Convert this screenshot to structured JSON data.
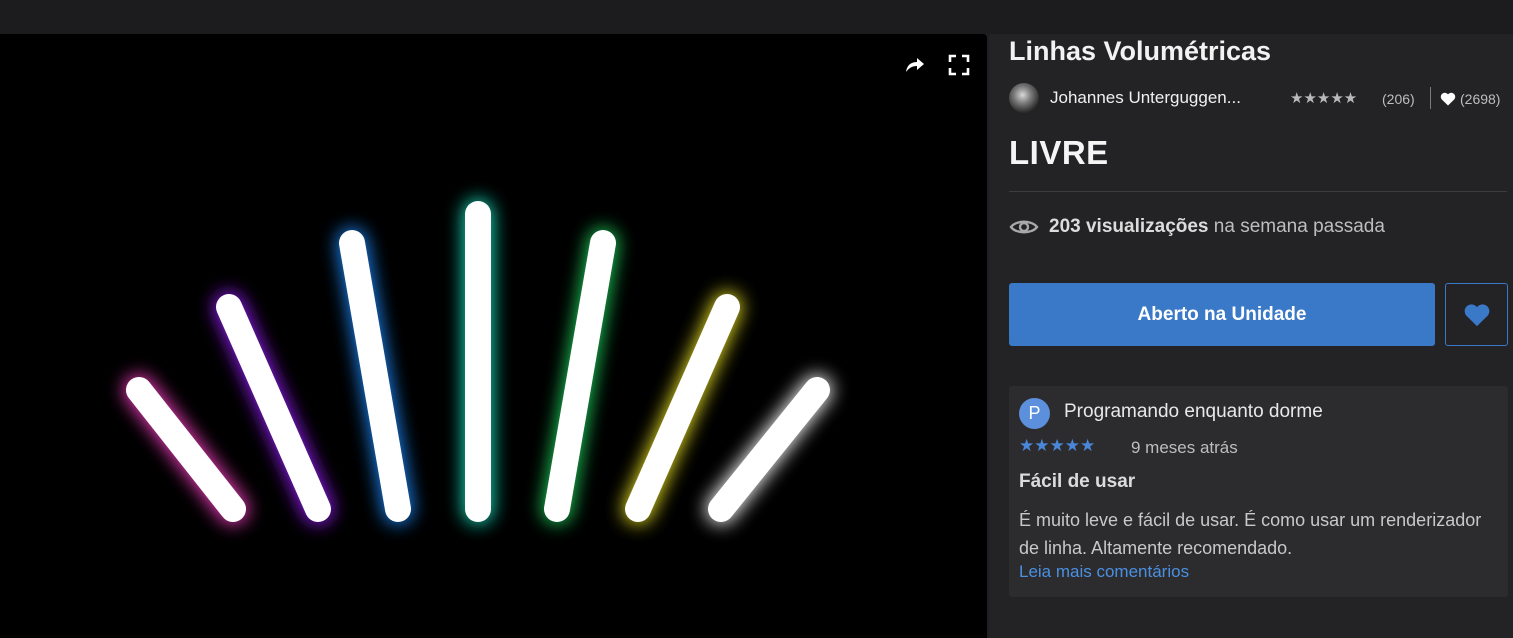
{
  "viewer": {
    "share_icon": "share-arrow-icon",
    "fullscreen_icon": "fullscreen-icon"
  },
  "asset": {
    "title": "Linhas Volumétricas",
    "author": "Johannes Unterguggen...",
    "stars": "★★★★★",
    "rating_count": "(206)",
    "favorites_count": "(2698)",
    "price": "LIVRE"
  },
  "views": {
    "count": "203 visualizações",
    "suffix": "na semana passada"
  },
  "actions": {
    "open_label": "Aberto na Unidade",
    "favorite_icon": "heart-icon"
  },
  "review": {
    "avatar_letter": "P",
    "author": "Programando enquanto dorme",
    "stars": "★★★★★",
    "time": "9 meses atrás",
    "title": "Fácil de usar",
    "body": "É muito leve e fácil de usar. É como usar um renderizador de linha. Altamente recomendado.",
    "more_link": "Leia mais comentários"
  },
  "colors": {
    "accent": "#3a78c8",
    "link": "#4a90e2",
    "glow_pink": "#ff3fc8",
    "glow_purple": "#9a1fff",
    "glow_blue": "#1e8bff",
    "glow_teal": "#19e0c0",
    "glow_green": "#1fd05a",
    "glow_yellow": "#e8e020",
    "glow_white": "#ffffff"
  }
}
